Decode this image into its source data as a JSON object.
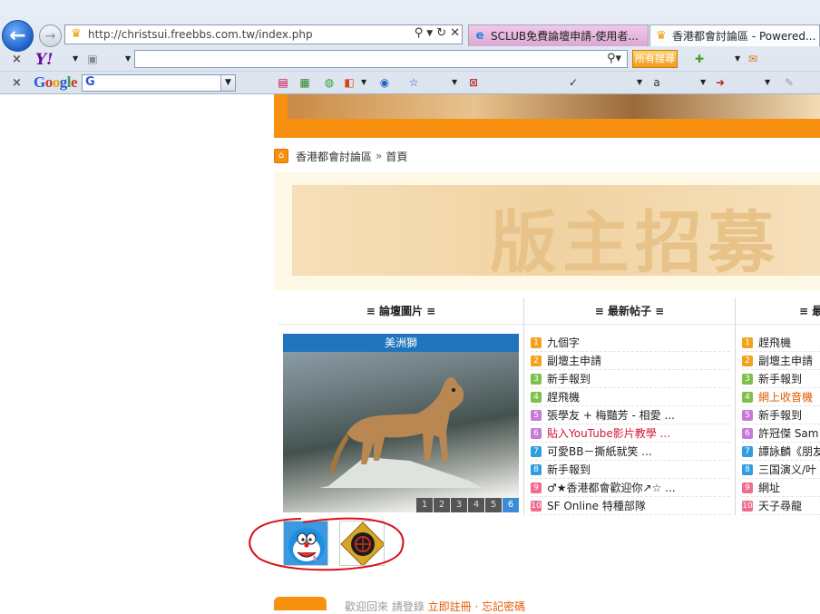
{
  "browser": {
    "address": "http://christsui.freebbs.com.tw/index.php",
    "tabs": [
      {
        "label": "SCLUB免費論壇申請-使用者..."
      },
      {
        "label": "香港都會討論區 - Powered..."
      }
    ],
    "yahoo_toolbar": {
      "search_button": "所有搜尋"
    },
    "google_toolbar": {
      "logo": "Google"
    }
  },
  "forum": {
    "breadcrumb": {
      "site": "香港都會討論區",
      "separator": "»",
      "page": "首頁"
    },
    "recruit_banner_text": "版主招募",
    "columns": [
      {
        "header": "≡ 論壇圖片 ≡"
      },
      {
        "header": "≡ 最新帖子 ≡"
      },
      {
        "header": "≡ 最"
      }
    ],
    "slideshow": {
      "caption": "美洲獅",
      "pages": [
        "1",
        "2",
        "3",
        "4",
        "5",
        "6"
      ],
      "active_page": 6
    },
    "latest_posts": [
      {
        "rank": "1",
        "title": "九個字"
      },
      {
        "rank": "2",
        "title": "副壇主申請"
      },
      {
        "rank": "3",
        "title": "新手報到"
      },
      {
        "rank": "4",
        "title": "趕飛機"
      },
      {
        "rank": "5",
        "title": "張學友 + 梅豔芳 - 相愛 ..."
      },
      {
        "rank": "6",
        "title": "貼入YouTube影片教學 ..."
      },
      {
        "rank": "7",
        "title": "可愛BB－撕紙就笑 ..."
      },
      {
        "rank": "8",
        "title": "新手報到"
      },
      {
        "rank": "9",
        "title": "♂★香港都會歡迎你↗☆ ..."
      },
      {
        "rank": "10",
        "title": "SF Online 特種部隊"
      }
    ],
    "hot_posts": [
      {
        "rank": "1",
        "title": "趕飛機"
      },
      {
        "rank": "2",
        "title": "副壇主申請"
      },
      {
        "rank": "3",
        "title": "新手報到"
      },
      {
        "rank": "4",
        "title": "網上收音機"
      },
      {
        "rank": "5",
        "title": "新手報到"
      },
      {
        "rank": "6",
        "title": "許冠傑 Sam"
      },
      {
        "rank": "7",
        "title": "譚詠麟《朋友"
      },
      {
        "rank": "8",
        "title": "三国演义/叶"
      },
      {
        "rank": "9",
        "title": "網址"
      },
      {
        "rank": "10",
        "title": "天子尋龍"
      }
    ],
    "footer_text": "歡迎回來 請登錄",
    "footer_link": "立即註冊 · 忘記密碼"
  },
  "colors": {
    "accent_orange": "#f7900e",
    "tab_pink": "#d9a8d3",
    "link_red": "#d0183a",
    "annotation_red": "#d8101a"
  }
}
